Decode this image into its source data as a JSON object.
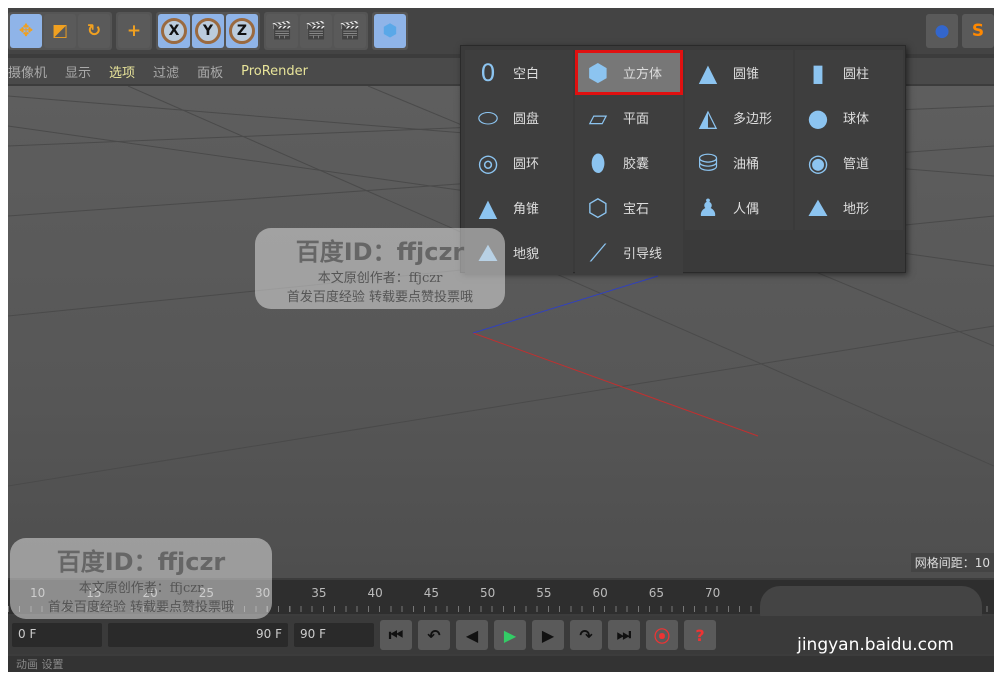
{
  "toolbar": {
    "axes": [
      "X",
      "Y",
      "Z"
    ]
  },
  "menubar": {
    "items": [
      "摄像机",
      "显示",
      "选项",
      "过滤",
      "面板",
      "ProRender"
    ]
  },
  "primitives_menu": {
    "columns": [
      [
        {
          "label": "空白",
          "icon": "null-icon"
        },
        {
          "label": "圆盘",
          "icon": "disc-icon"
        },
        {
          "label": "圆环",
          "icon": "torus-icon"
        },
        {
          "label": "角锥",
          "icon": "pyramid-icon"
        },
        {
          "label": "地貌",
          "icon": "landscape-icon"
        }
      ],
      [
        {
          "label": "立方体",
          "icon": "cube-icon",
          "highlighted": true
        },
        {
          "label": "平面",
          "icon": "plane-icon"
        },
        {
          "label": "胶囊",
          "icon": "capsule-icon"
        },
        {
          "label": "宝石",
          "icon": "gem-icon"
        },
        {
          "label": "引导线",
          "icon": "guide-icon"
        }
      ],
      [
        {
          "label": "圆锥",
          "icon": "cone-icon"
        },
        {
          "label": "多边形",
          "icon": "polygon-icon"
        },
        {
          "label": "油桶",
          "icon": "oil-tank-icon"
        },
        {
          "label": "人偶",
          "icon": "figure-icon"
        }
      ],
      [
        {
          "label": "圆柱",
          "icon": "cylinder-icon"
        },
        {
          "label": "球体",
          "icon": "sphere-icon"
        },
        {
          "label": "管道",
          "icon": "tube-icon"
        },
        {
          "label": "地形",
          "icon": "terrain-icon"
        }
      ]
    ]
  },
  "viewport": {
    "grid_spacing": "网格间距：10"
  },
  "timeline": {
    "ticks": [
      "10",
      "15",
      "20",
      "25",
      "30",
      "35",
      "40",
      "45",
      "50",
      "55",
      "60",
      "65",
      "70"
    ]
  },
  "controls": {
    "start": "0 F",
    "end": "90 F",
    "max": "90 F"
  },
  "status": {
    "text": "动画  设置"
  },
  "watermark": {
    "id": "百度ID：ffjczr",
    "author": "本文原创作者：ffjczr",
    "note": "首发百度经验  转载要点赞投票哦",
    "site": "jingyan.baidu.com"
  }
}
